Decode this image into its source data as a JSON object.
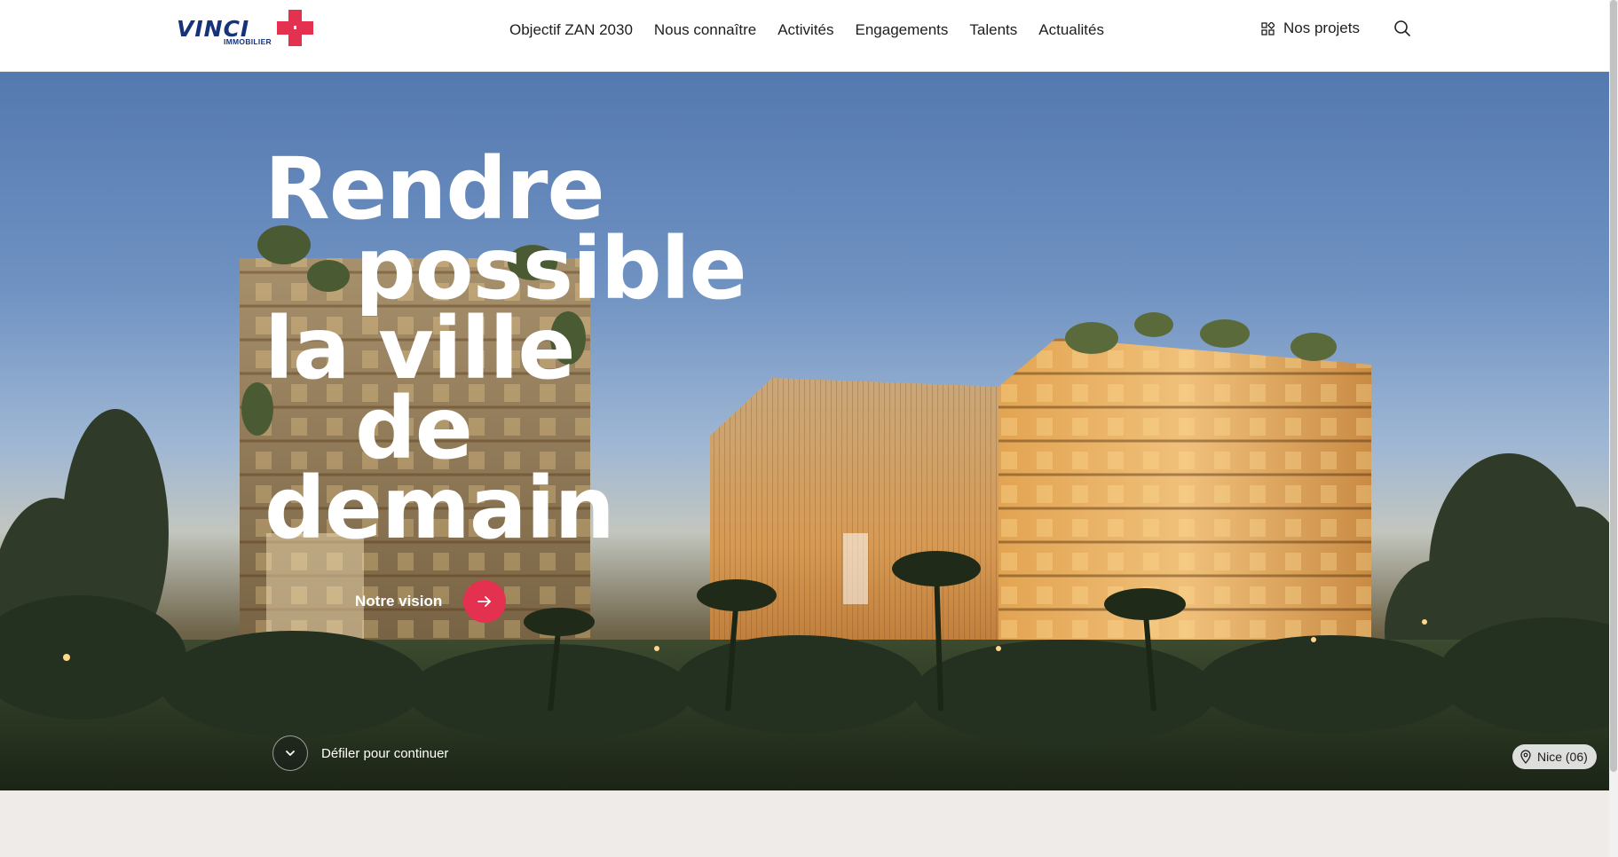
{
  "brand": {
    "name": "VINCI",
    "sub": "IMMOBILIER",
    "accent": "#e4314f",
    "navy": "#16337a"
  },
  "nav": {
    "items": [
      {
        "label": "Objectif ZAN 2030"
      },
      {
        "label": "Nous connaître"
      },
      {
        "label": "Activités"
      },
      {
        "label": "Engagements"
      },
      {
        "label": "Talents"
      },
      {
        "label": "Actualités"
      }
    ],
    "projects_label": "Nos projets",
    "projects_icon": "grid-icon",
    "search_icon": "search-icon"
  },
  "hero": {
    "headline": [
      "Rendre",
      "possible",
      "la ville",
      "de",
      "demain"
    ],
    "cta_label": "Notre vision",
    "cta_icon": "arrow-right-icon",
    "scroll_label": "Défiler pour continuer",
    "scroll_icon": "chevron-down-icon",
    "location_label": "Nice (06)",
    "location_icon": "map-pin-icon"
  }
}
